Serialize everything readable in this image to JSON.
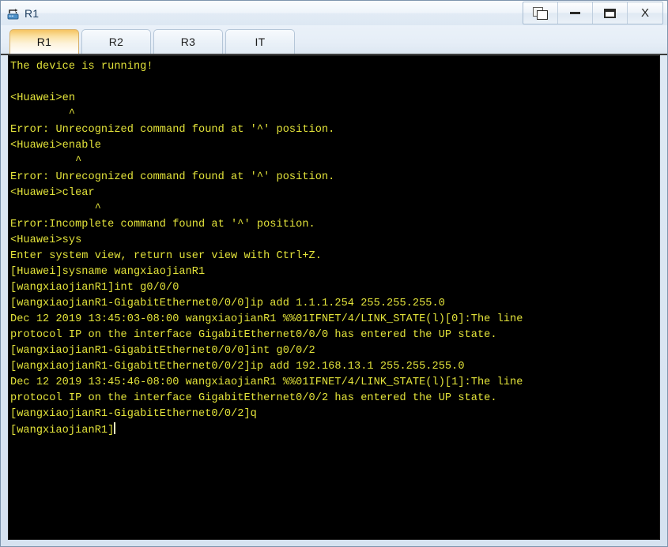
{
  "window": {
    "title": "R1",
    "icon": "router-icon",
    "controls": [
      {
        "name": "restore-button",
        "label": "",
        "icon": "restore-icon"
      },
      {
        "name": "minimize-button",
        "label": "",
        "icon": "minimize-icon"
      },
      {
        "name": "maximize-button",
        "label": "",
        "icon": "maximize-icon"
      },
      {
        "name": "close-button",
        "label": "X",
        "icon": "close-icon"
      }
    ]
  },
  "tabs": [
    {
      "label": "R1",
      "active": true
    },
    {
      "label": "R2",
      "active": false
    },
    {
      "label": "R3",
      "active": false
    },
    {
      "label": "IT",
      "active": false
    }
  ],
  "terminal": {
    "background_color": "#000000",
    "text_color": "#e3e33a",
    "cursor_visible": true,
    "lines": [
      "The device is running!",
      "",
      "<Huawei>en",
      "         ^",
      "Error: Unrecognized command found at '^' position.",
      "<Huawei>enable",
      "          ^",
      "Error: Unrecognized command found at '^' position.",
      "<Huawei>clear",
      "             ^",
      "Error:Incomplete command found at '^' position.",
      "<Huawei>sys",
      "Enter system view, return user view with Ctrl+Z.",
      "[Huawei]sysname wangxiaojianR1",
      "[wangxiaojianR1]int g0/0/0",
      "[wangxiaojianR1-GigabitEthernet0/0/0]ip add 1.1.1.254 255.255.255.0",
      "Dec 12 2019 13:45:03-08:00 wangxiaojianR1 %%01IFNET/4/LINK_STATE(l)[0]:The line",
      "protocol IP on the interface GigabitEthernet0/0/0 has entered the UP state.",
      "[wangxiaojianR1-GigabitEthernet0/0/0]int g0/0/2",
      "[wangxiaojianR1-GigabitEthernet0/0/2]ip add 192.168.13.1 255.255.255.0",
      "Dec 12 2019 13:45:46-08:00 wangxiaojianR1 %%01IFNET/4/LINK_STATE(l)[1]:The line",
      "protocol IP on the interface GigabitEthernet0/0/2 has entered the UP state.",
      "[wangxiaojianR1-GigabitEthernet0/0/2]q"
    ],
    "prompt": "[wangxiaojianR1]"
  }
}
